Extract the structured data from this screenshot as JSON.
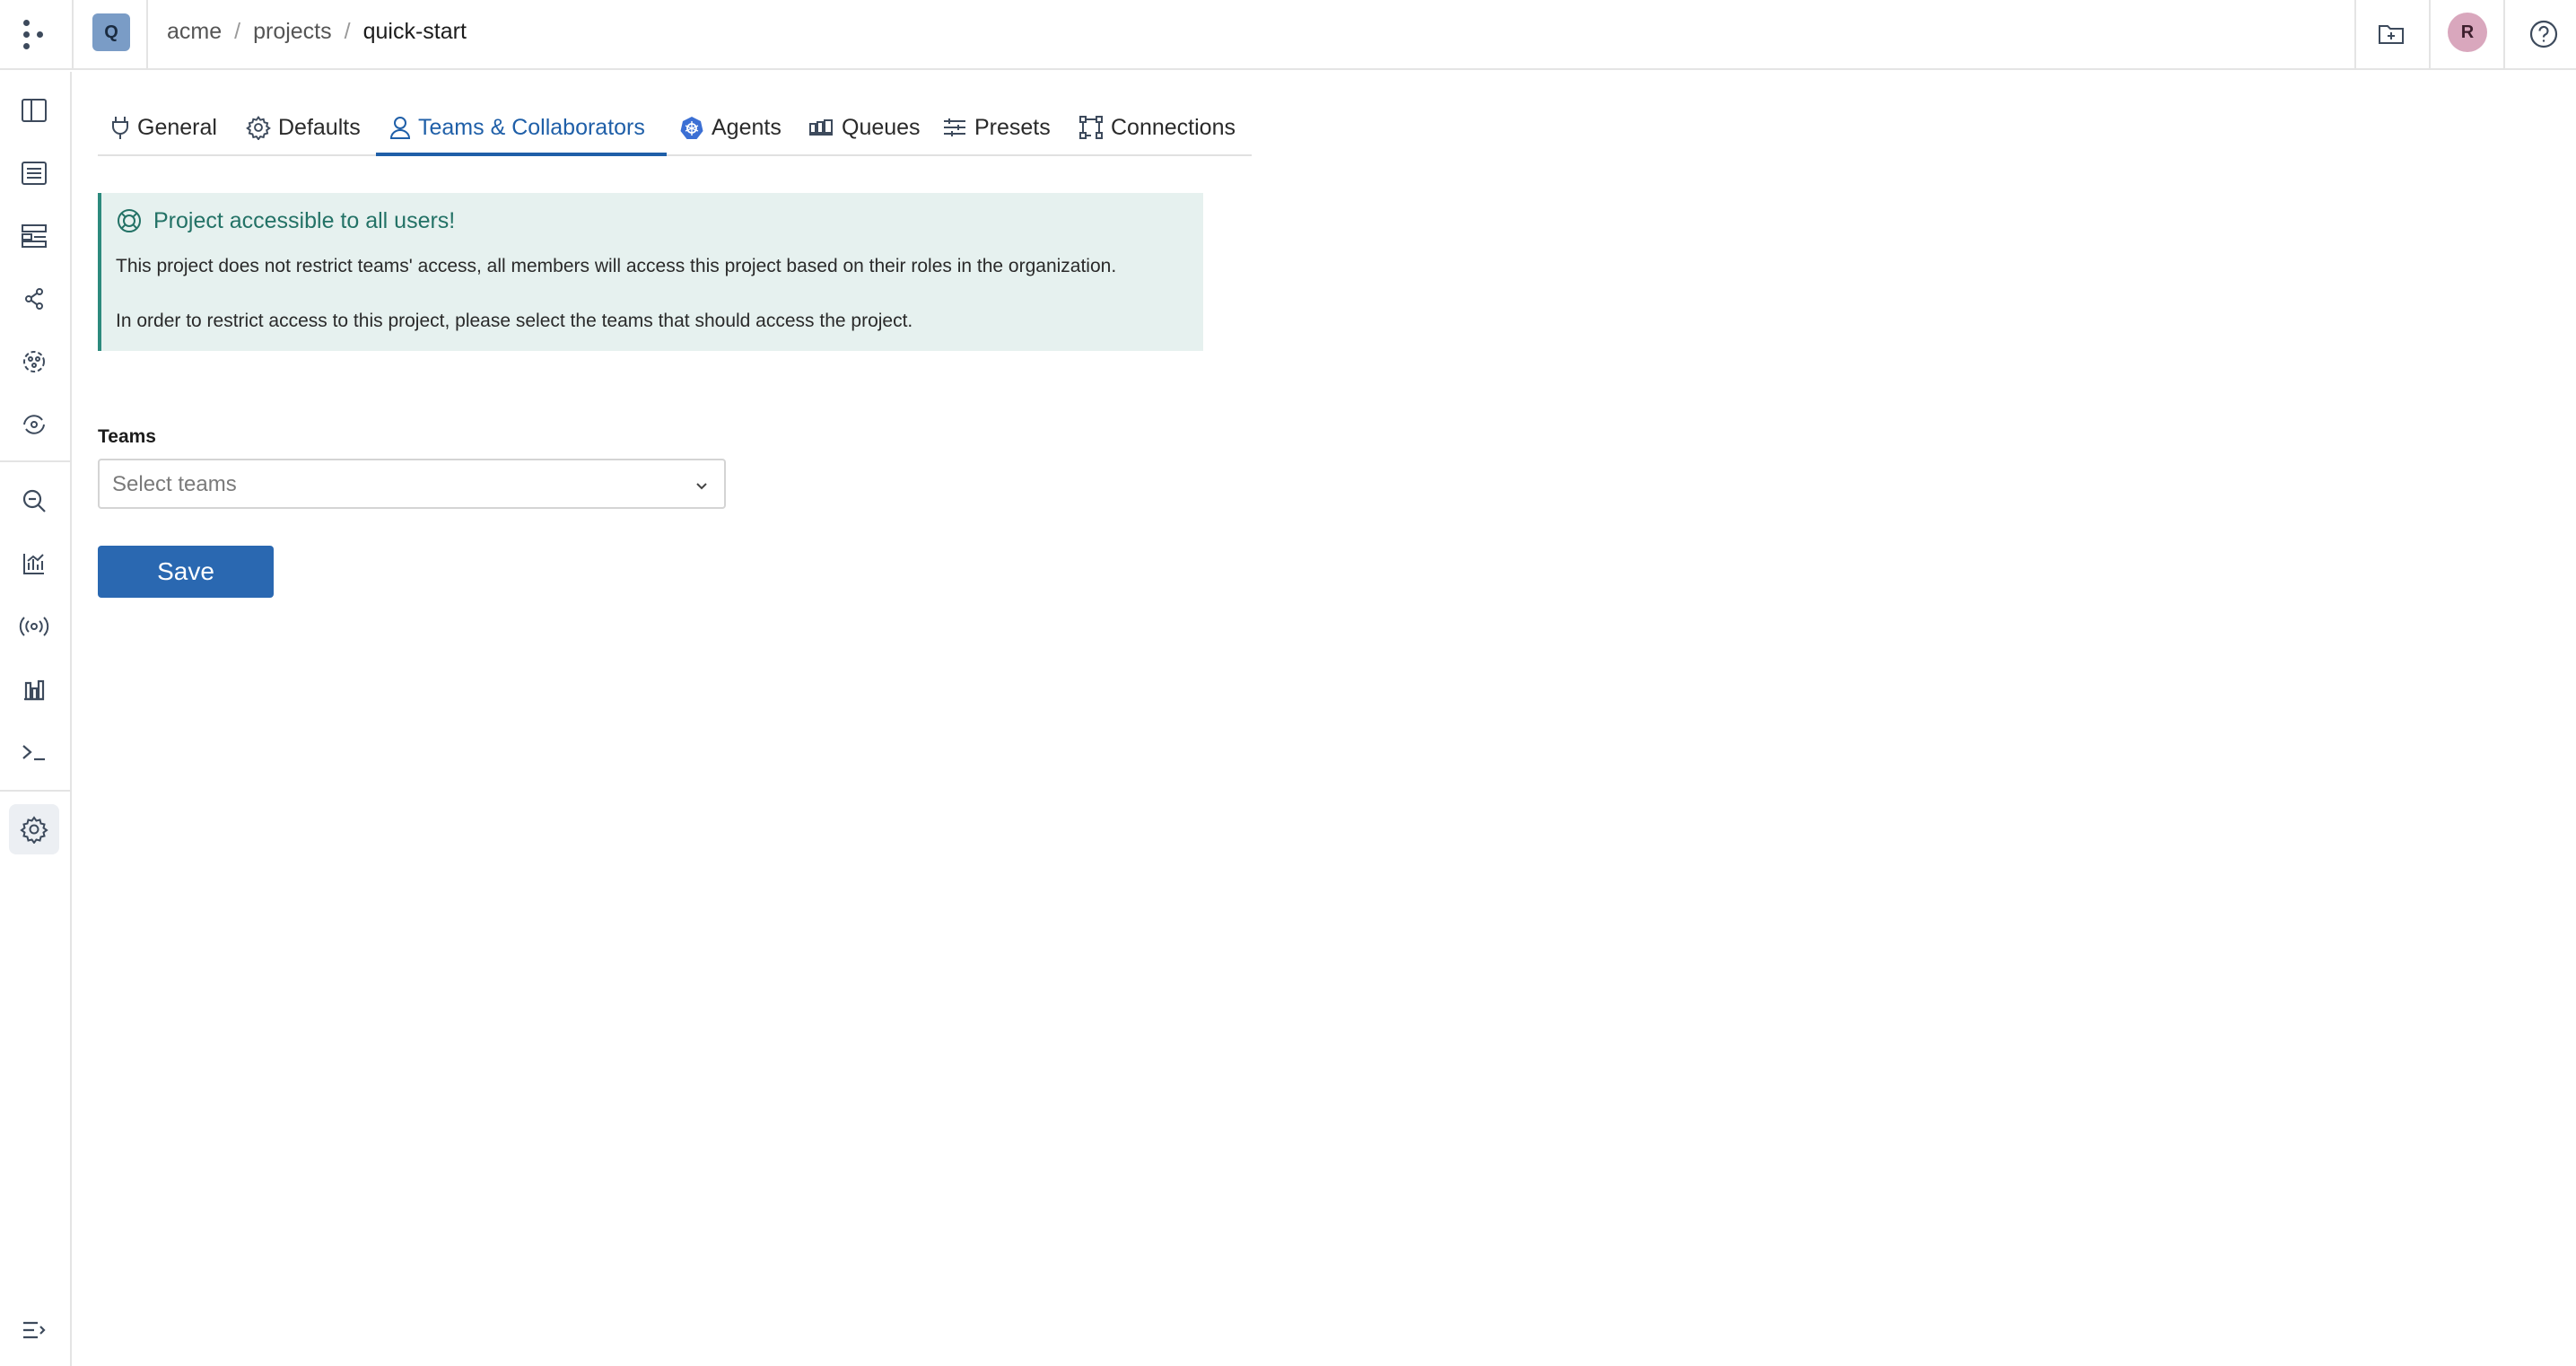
{
  "header": {
    "project_initial": "Q",
    "breadcrumb": [
      "acme",
      "projects",
      "quick-start"
    ],
    "breadcrumb_separator": "/",
    "user_initial": "R",
    "icons": [
      "apps-grid-icon",
      "new-folder-icon",
      "help-icon"
    ]
  },
  "sidebar": {
    "items": [
      {
        "name": "overview",
        "icon": "book-icon"
      },
      {
        "name": "runs",
        "icon": "list-icon"
      },
      {
        "name": "components",
        "icon": "layout-icon"
      },
      {
        "name": "lineage",
        "icon": "graph-icon"
      },
      {
        "name": "models",
        "icon": "brain-icon"
      },
      {
        "name": "monitoring",
        "icon": "eye-cycle-icon"
      },
      {
        "name": "search",
        "icon": "search-icon"
      },
      {
        "name": "analytics",
        "icon": "chart-icon"
      },
      {
        "name": "streams",
        "icon": "broadcast-icon"
      },
      {
        "name": "dashboards",
        "icon": "bar-chart-icon"
      },
      {
        "name": "terminal",
        "icon": "terminal-icon"
      },
      {
        "name": "settings",
        "icon": "gear-icon",
        "active": true
      }
    ],
    "footer_icon": "collapse-menu-icon"
  },
  "tabs": [
    {
      "label": "General",
      "icon": "plug-icon"
    },
    {
      "label": "Defaults",
      "icon": "gear-icon"
    },
    {
      "label": "Teams & Collaborators",
      "icon": "user-icon",
      "active": true
    },
    {
      "label": "Agents",
      "icon": "kubernetes-icon"
    },
    {
      "label": "Queues",
      "icon": "queue-icon"
    },
    {
      "label": "Presets",
      "icon": "sliders-icon"
    },
    {
      "label": "Connections",
      "icon": "connections-icon"
    }
  ],
  "alert": {
    "title": "Project accessible to all users!",
    "line1": "This project does not restrict teams' access, all members will access this project based on their roles in the organization.",
    "line2": "In order to restrict access to this project, please select the teams that should access the project."
  },
  "form": {
    "teams_label": "Teams",
    "teams_placeholder": "Select teams",
    "save_label": "Save"
  },
  "colors": {
    "accent": "#1f5fa8",
    "save_button": "#2a68b1",
    "alert_bg": "#e6f1ef",
    "alert_text": "#237266",
    "project_avatar": "#7a9cc6",
    "user_avatar": "#d9a7bd"
  }
}
